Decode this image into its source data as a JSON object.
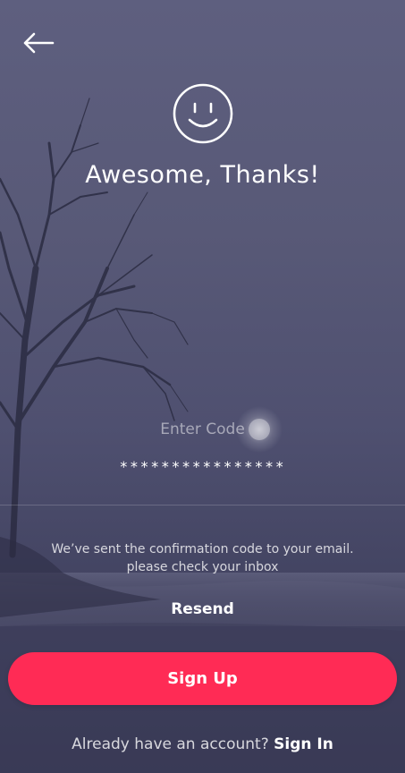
{
  "header": {
    "back_icon": "arrow-left-icon"
  },
  "hero": {
    "icon": "smiley-icon",
    "title": "Awesome, Thanks!"
  },
  "code": {
    "label": "Enter Code",
    "value": "****************"
  },
  "info": {
    "line1": "We’ve sent the confirmation code to your email.",
    "line2": "please check your inbox"
  },
  "actions": {
    "resend_label": "Resend",
    "signup_label": "Sign Up"
  },
  "footer": {
    "prompt": "Already have an account?",
    "signin_label": "Sign In"
  },
  "colors": {
    "primary": "#ff2b55",
    "background": "#555677",
    "text": "#ffffff"
  }
}
